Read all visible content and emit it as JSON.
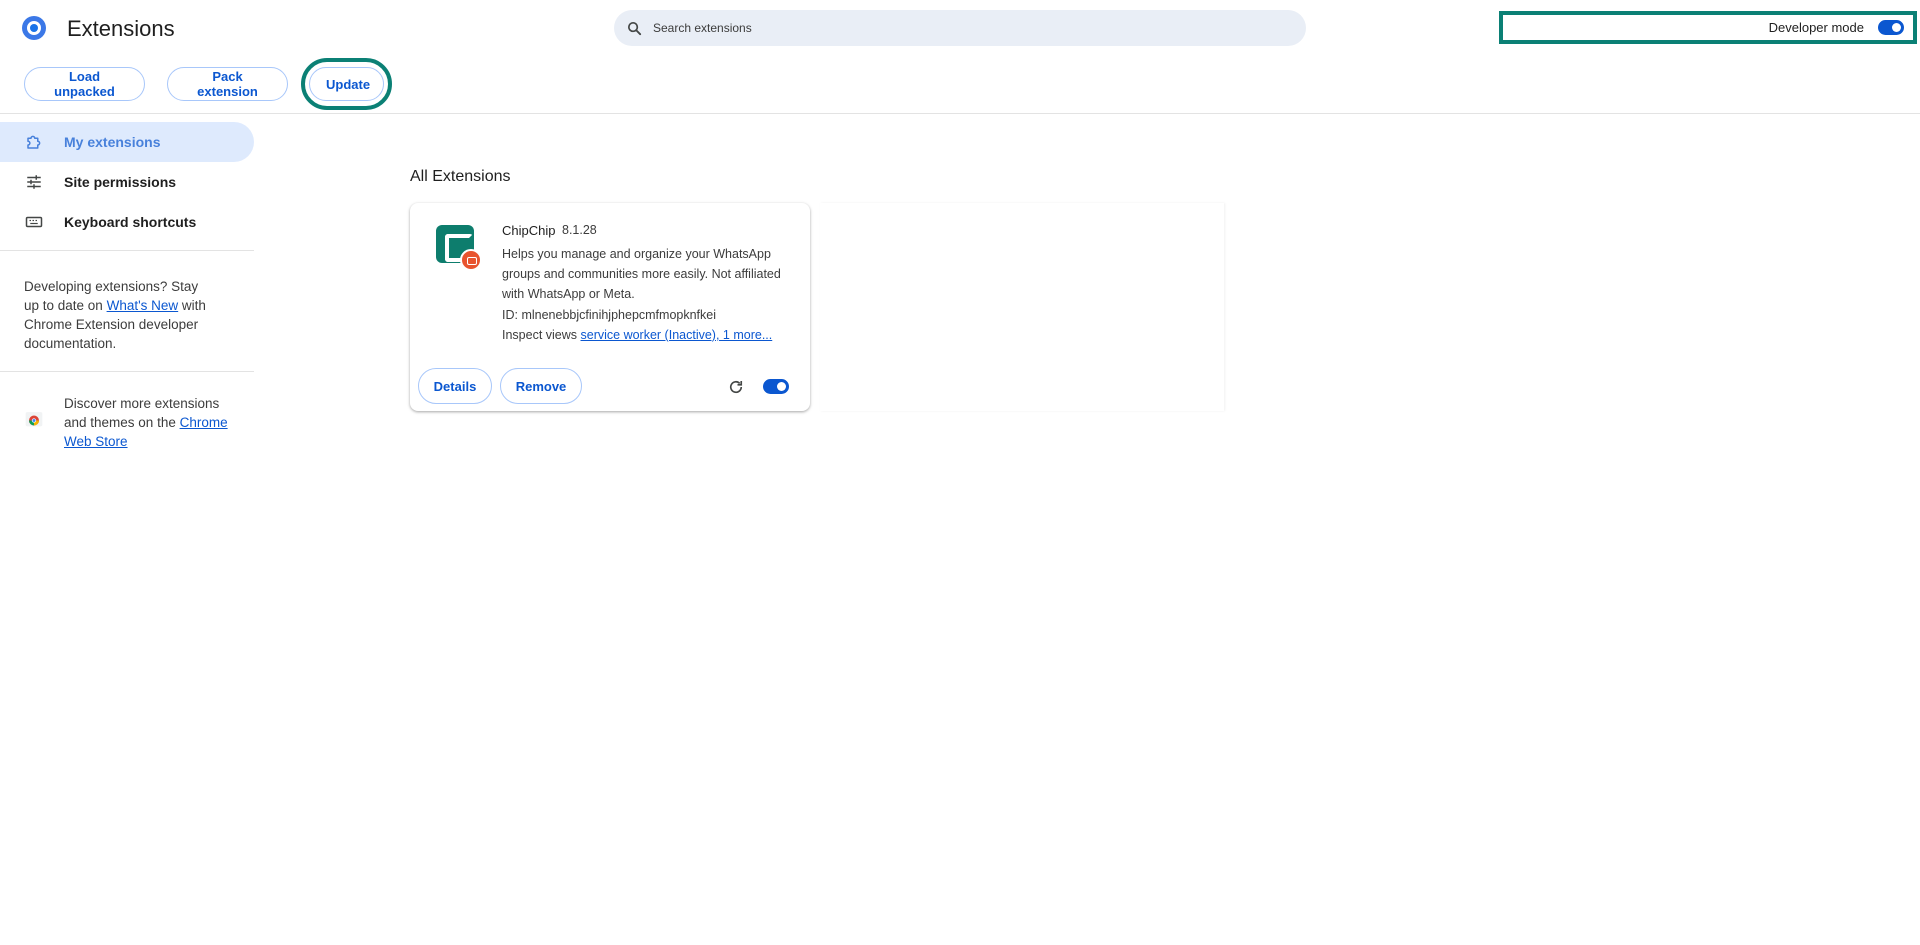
{
  "header": {
    "title": "Extensions",
    "search_placeholder": "Search extensions",
    "developer_mode_label": "Developer mode",
    "developer_mode_on": true
  },
  "toolbar": {
    "load_unpacked": "Load unpacked",
    "pack_extension": "Pack extension",
    "update": "Update"
  },
  "sidebar": {
    "items": [
      {
        "label": "My extensions",
        "icon": "extension-icon",
        "active": true
      },
      {
        "label": "Site permissions",
        "icon": "tune-sliders-icon",
        "active": false
      },
      {
        "label": "Keyboard shortcuts",
        "icon": "keyboard-icon",
        "active": false
      }
    ],
    "developing_text_1": "Developing extensions? Stay up to date on ",
    "whats_new_link": "What's New",
    "developing_text_2": " with Chrome Extension developer documentation.",
    "store_text": "Discover more extensions and themes on the ",
    "store_link": "Chrome Web Store"
  },
  "main": {
    "section_title": "All Extensions",
    "extensions": [
      {
        "name": "ChipChip",
        "version": "8.1.28",
        "description": "Helps you manage and organize your WhatsApp groups and communities more easily. Not affiliated with WhatsApp or Meta.",
        "id_label": "ID: mlnenebbjcfinihjphepcmfmopknfkei",
        "inspect_label": "Inspect views ",
        "inspect_link": "service worker (Inactive), 1 more...",
        "details_label": "Details",
        "remove_label": "Remove",
        "enabled": true
      }
    ]
  },
  "colors": {
    "accent": "#0b57d0",
    "highlight_ring": "#0b8075",
    "active_nav_bg": "#d3e3fd",
    "search_bg": "#e9eef6"
  }
}
